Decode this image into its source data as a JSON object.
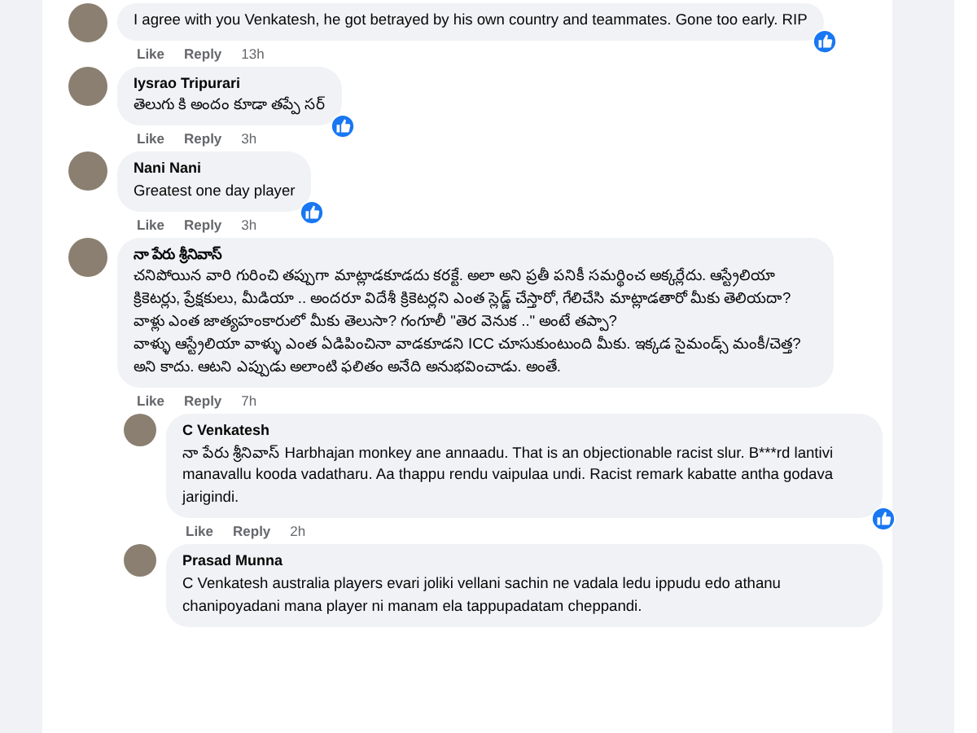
{
  "comments": [
    {
      "text": "I agree with you Venkatesh, he got betrayed by his own country and teammates. Gone too early. RIP",
      "liked": true,
      "actions": {
        "like": "Like",
        "reply": "Reply",
        "time": "13h"
      }
    },
    {
      "author": "Iysrao Tripurari",
      "text": "తెలుగు కి అందం కూడా తప్పే సర్",
      "liked": true,
      "actions": {
        "like": "Like",
        "reply": "Reply",
        "time": "3h"
      }
    },
    {
      "author": "Nani Nani",
      "text": "Greatest one day player",
      "liked": true,
      "actions": {
        "like": "Like",
        "reply": "Reply",
        "time": "3h"
      }
    },
    {
      "author": "నా పేరు శ్రీనివాస్",
      "text": "చనిపోయిన వారి గురించి తప్పుగా మాట్లాడకూడదు కరక్టే. అలా అని ప్రతీ పనికీ సమర్థించ అక్కర్లేదు. ఆస్ట్రేలియా క్రికెటర్లు, ప్రేక్షకులు, మీడియా .. అందరూ విదేశీ క్రికెటర్లని ఎంత స్లెడ్జ్ చేస్తారో, గేలిచేసి మాట్లాడతారో మీకు తెలియదా? వాళ్లు ఎంత జాత్యహంకారులో మీకు తెలుసా? గంగూలీ \"తెర వెనుక ..\" అంటే తప్పా?\nవాళ్ళు ఆస్ట్రేలియా వాళ్ళు ఎంత ఏడిపించినా వాడకూడని ICC చూసుకుంటుంది మీకు. ఇక్కడ సైమండ్స్ మంకీ/చెత్త? అని కాదు. ఆటని ఎప్పుడు అలాంటి ఫలితం అనేది అనుభవించాడు. అంతే.",
      "liked": false,
      "actions": {
        "like": "Like",
        "reply": "Reply",
        "time": "7h"
      },
      "children": [
        {
          "author": "C Venkatesh",
          "text": "నా పేరు శ్రీనివాస్ Harbhajan monkey ane annaadu. That is an objectionable racist slur. B***rd lantivi manavallu kooda vadatharu. Aa thappu rendu vaipulaa undi. Racist remark kabatte antha godava jarigindi.",
          "liked": true,
          "actions": {
            "like": "Like",
            "reply": "Reply",
            "time": "2h"
          }
        },
        {
          "author": "Prasad Munna",
          "text": "C Venkatesh australia players evari joliki vellani sachin ne vadala ledu ippudu edo athanu chanipoyadani mana player ni manam ela tappupadatam cheppandi.",
          "liked": false
        }
      ]
    }
  ]
}
